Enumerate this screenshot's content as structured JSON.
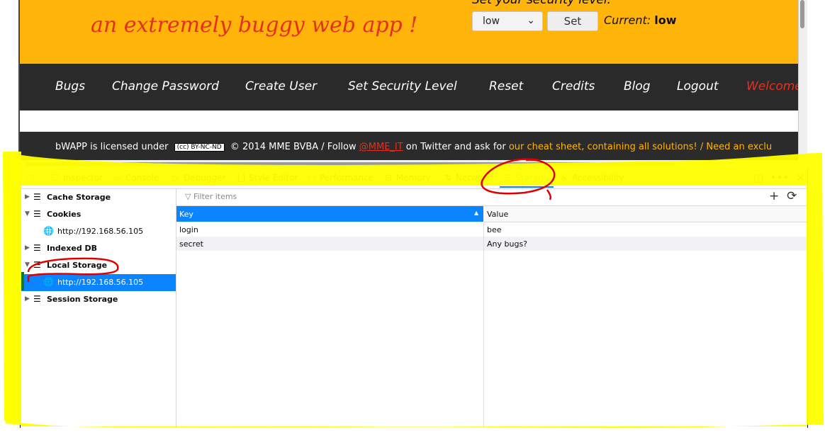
{
  "page": {
    "tagline": "an extremely buggy web app !",
    "security_label": "Set your security level:",
    "security_value": "low",
    "set_button": "Set",
    "current_label": "Current:",
    "current_value": "low",
    "nav": [
      "Bugs",
      "Change Password",
      "Create User",
      "Set Security Level",
      "Reset",
      "Credits",
      "Blog",
      "Logout",
      "Welcome"
    ],
    "footer": {
      "prefix": "bWAPP is licensed under",
      "cc_badge": "(cc) BY-NC-ND",
      "copyright": "© 2014 MME BVBA / Follow",
      "twitter": "@MME_IT",
      "mid": "on Twitter and ask for",
      "cheat": "our cheat sheet, containing all solutions! / Need an exclu"
    }
  },
  "devtools": {
    "tabs": [
      "Inspector",
      "Console",
      "Debugger",
      "Style Editor",
      "Performance",
      "Memory",
      "Network",
      "Storage",
      "Accessibility"
    ],
    "active_tab": "Storage",
    "tree": {
      "cache": "Cache Storage",
      "cookies": "Cookies",
      "cookies_host": "http://192.168.56.105",
      "indexeddb": "Indexed DB",
      "local": "Local Storage",
      "local_host": "http://192.168.56.105",
      "session": "Session Storage"
    },
    "filter_placeholder": "Filter items",
    "columns": {
      "key": "Key",
      "value": "Value"
    },
    "rows": [
      {
        "key": "login",
        "value": "bee"
      },
      {
        "key": "secret",
        "value": "Any bugs?"
      }
    ]
  },
  "colors": {
    "accent": "#0a84ff",
    "highlight": "#ffff00",
    "annotation": "#e00000",
    "brand": "#ffb40a"
  }
}
